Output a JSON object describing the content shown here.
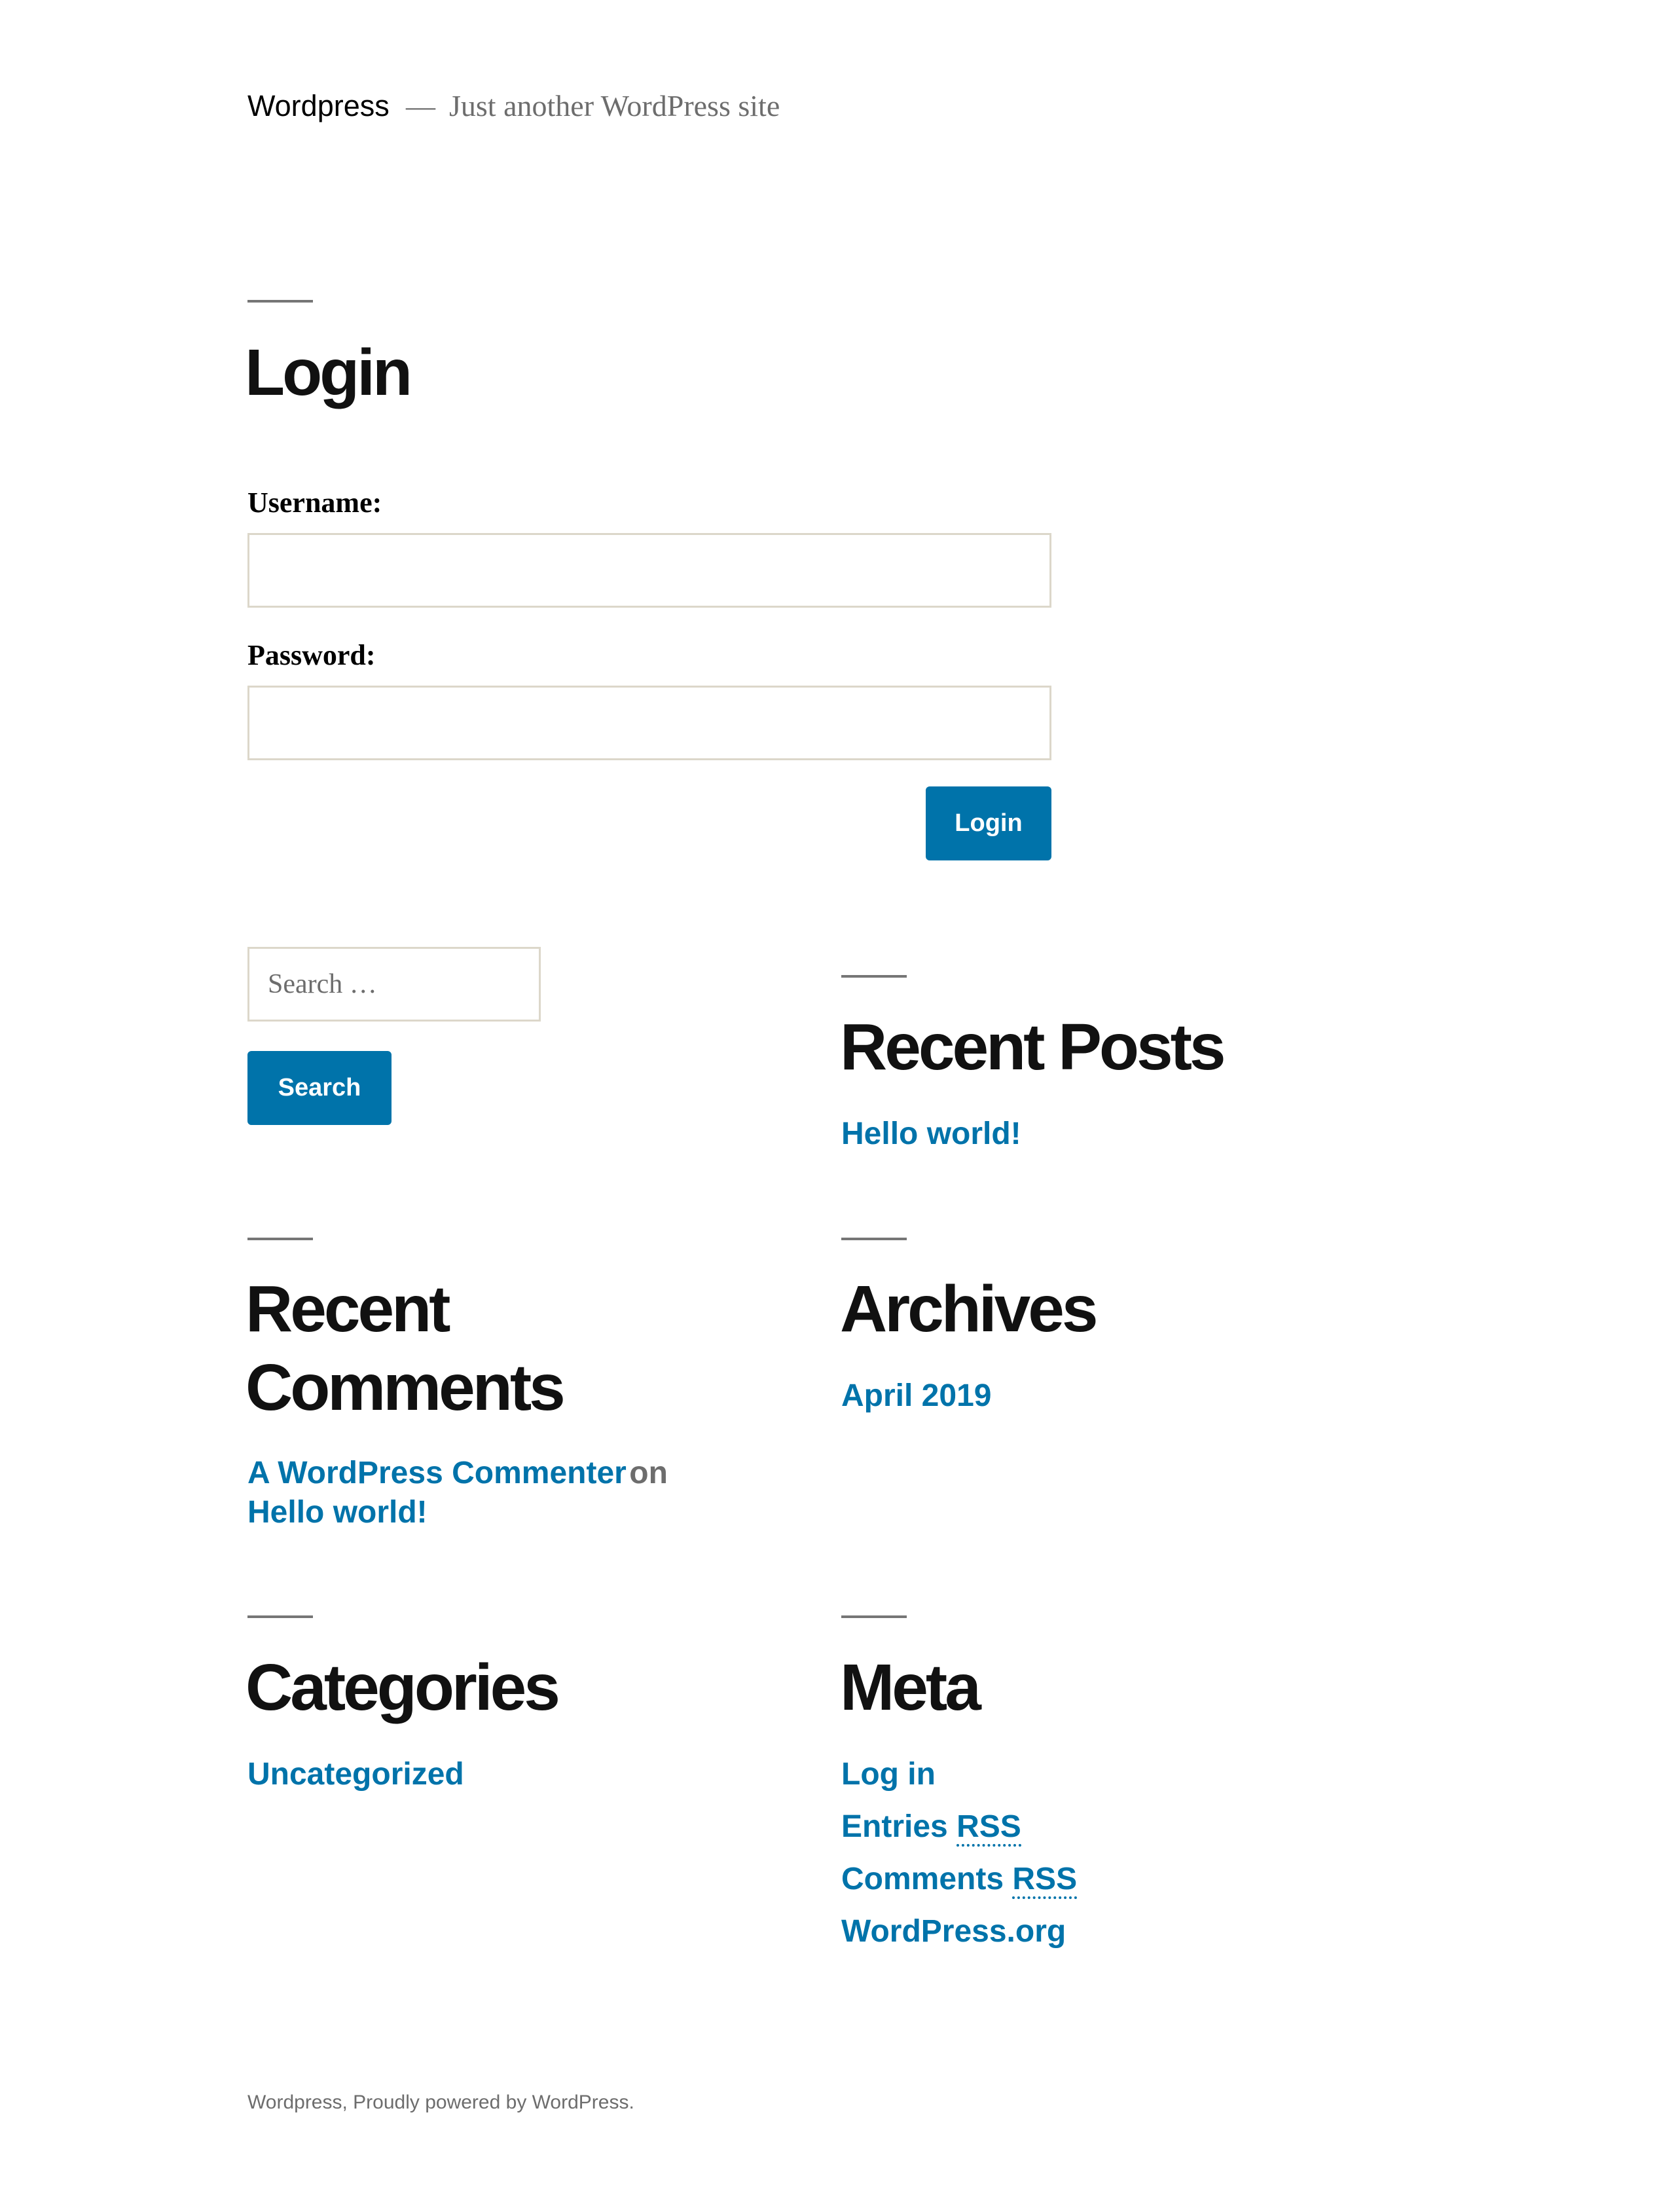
{
  "header": {
    "site_title": "Wordpress",
    "separator": "—",
    "description": "Just another WordPress site"
  },
  "login": {
    "title": "Login",
    "username_label": "Username:",
    "username_value": "",
    "password_label": "Password:",
    "password_value": "",
    "submit_label": "Login"
  },
  "search": {
    "placeholder": "Search …",
    "button_label": "Search"
  },
  "recent_posts": {
    "title": "Recent Posts",
    "items": [
      "Hello world!"
    ]
  },
  "recent_comments": {
    "title_line1": "Recent",
    "title_line2": "Comments",
    "items": [
      {
        "author": "A WordPress Commenter",
        "connector": "on",
        "post": "Hello world!"
      }
    ]
  },
  "archives": {
    "title": "Archives",
    "items": [
      "April 2019"
    ]
  },
  "categories": {
    "title": "Categories",
    "items": [
      "Uncategorized"
    ]
  },
  "meta": {
    "title": "Meta",
    "log_in": "Log in",
    "entries_prefix": "Entries",
    "comments_prefix": "Comments",
    "rss": "RSS",
    "wordpress_org": "WordPress.org"
  },
  "footer": {
    "text": "Wordpress, Proudly powered by WordPress."
  },
  "colors": {
    "accent": "#0073aa",
    "heading": "#111111",
    "secondary": "#6d6d6d",
    "border": "#dcd7ca"
  }
}
